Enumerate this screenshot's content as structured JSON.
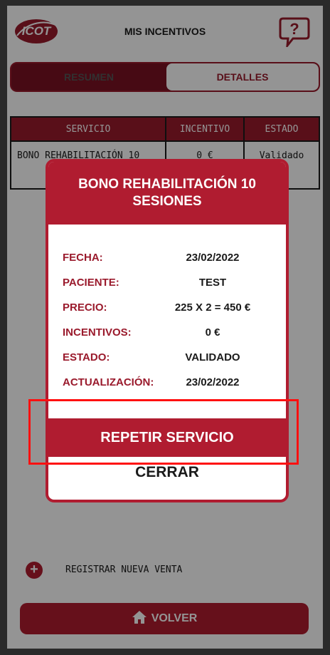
{
  "header": {
    "logo_text": "ICOT",
    "title": "MIS INCENTIVOS"
  },
  "tabs": [
    {
      "label": "RESUMEN"
    },
    {
      "label": "DETALLES"
    }
  ],
  "table": {
    "headers": [
      "SERVICIO",
      "INCENTIVO",
      "ESTADO"
    ],
    "rows": [
      [
        "BONO REHABILITACIÓN 10",
        "0 €",
        "Validado"
      ]
    ]
  },
  "footer": {
    "register_label": "REGISTRAR NUEVA VENTA",
    "volver_label": "VOLVER"
  },
  "modal": {
    "title": "BONO REHABILITACIÓN 10 SESIONES",
    "fields": [
      {
        "label": "FECHA:",
        "value": "23/02/2022"
      },
      {
        "label": "PACIENTE:",
        "value": "TEST"
      },
      {
        "label": "PRECIO:",
        "value": "225 X 2 = 450 €"
      },
      {
        "label": "INCENTIVOS:",
        "value": "0 €"
      },
      {
        "label": "ESTADO:",
        "value": "VALIDADO"
      },
      {
        "label": "ACTUALIZACIÓN:",
        "value": "23/02/2022"
      }
    ],
    "repeat_label": "REPETIR SERVICIO",
    "close_label": "CERRAR"
  },
  "colors": {
    "brand": "#b01c30",
    "brand_dark": "#9a1a2c",
    "highlight": "#ff1010"
  }
}
